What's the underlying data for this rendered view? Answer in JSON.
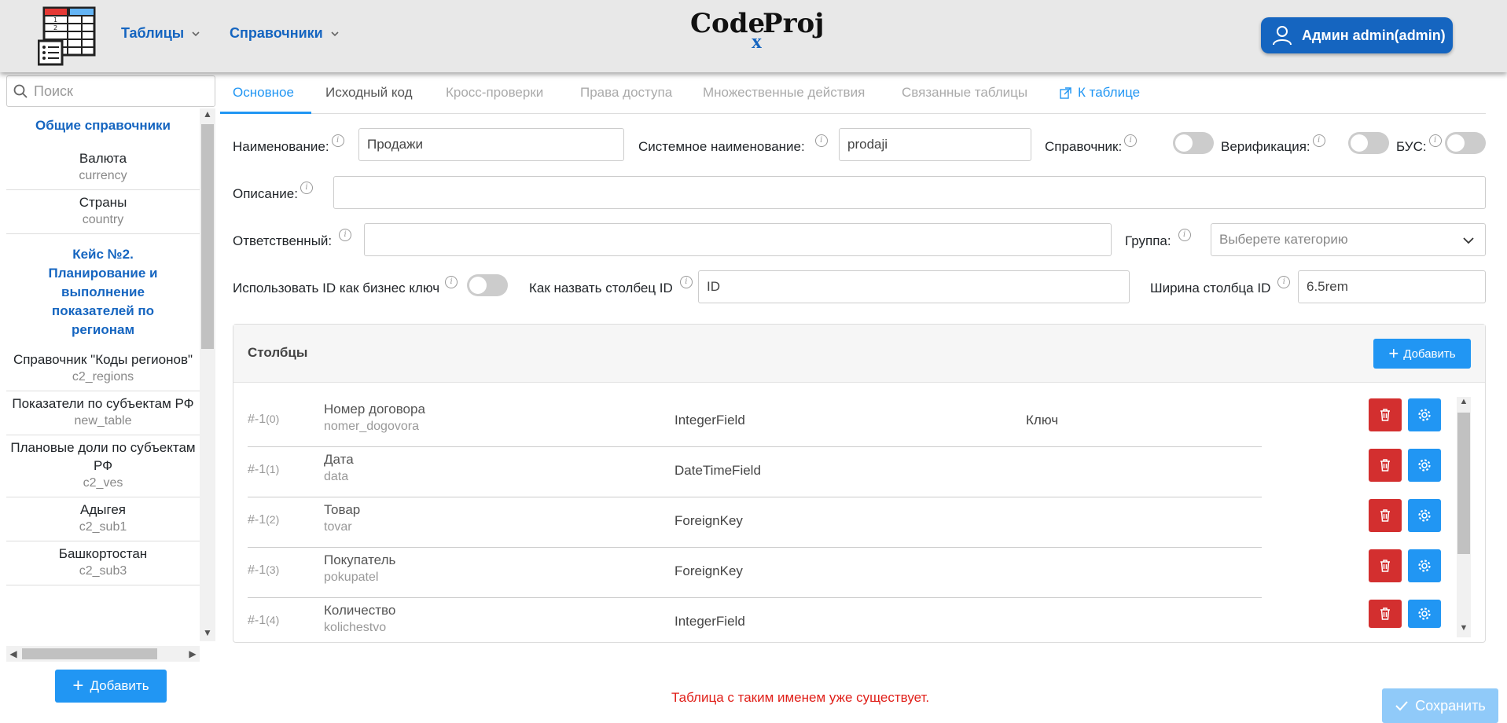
{
  "header": {
    "nav_tables": "Таблицы",
    "nav_directories": "Справочники",
    "brand_code": "Code",
    "brand_x": "x",
    "brand_proj": "Proj",
    "user_label": "Админ admin(admin)"
  },
  "sidebar": {
    "search_placeholder": "Поиск",
    "groups": [
      {
        "label": "Общие справочники"
      },
      {
        "label": "Кейс №2. Планирование и выполнение показателей по регионам"
      }
    ],
    "items": [
      {
        "label": "Валюта",
        "sys": "currency"
      },
      {
        "label": "Страны",
        "sys": "country"
      },
      {
        "label": "Справочник \"Коды регионов\"",
        "sys": "c2_regions"
      },
      {
        "label": "Показатели по субъектам РФ",
        "sys": "new_table"
      },
      {
        "label": "Плановые доли по субъектам РФ",
        "sys": "c2_ves"
      },
      {
        "label": "Адыгея",
        "sys": "c2_sub1"
      },
      {
        "label": "Башкортостан",
        "sys": "c2_sub3"
      }
    ],
    "add_label": "Добавить"
  },
  "tabs": [
    {
      "label": "Основное"
    },
    {
      "label": "Исходный код"
    },
    {
      "label": "Кросс-проверки"
    },
    {
      "label": "Права доступа"
    },
    {
      "label": "Множественные действия"
    },
    {
      "label": "Связанные таблицы"
    },
    {
      "label": "К таблице"
    }
  ],
  "form": {
    "name_label": "Наименование:",
    "name_value": "Продажи",
    "sysname_label": "Системное наименование:",
    "sysname_value": "prodaji",
    "directory_label": "Справочник:",
    "verification_label": "Верификация:",
    "bus_label": "БУС:",
    "description_label": "Описание:",
    "description_value": "",
    "responsible_label": "Ответственный:",
    "responsible_value": "",
    "group_label": "Группа:",
    "group_placeholder": "Выберете категорию",
    "use_id_label": "Использовать ID как бизнес ключ",
    "id_col_name_label": "Как назвать столбец ID",
    "id_col_name_value": "ID",
    "id_col_width_label": "Ширина столбца ID",
    "id_col_width_value": "6.5rem"
  },
  "columns": {
    "title": "Столбцы",
    "add_label": "Добавить",
    "rows": [
      {
        "idx": "#-1",
        "pos": "(0)",
        "name": "Номер договора",
        "sys": "nomer_dogovora",
        "type": "IntegerField",
        "key": "Ключ"
      },
      {
        "idx": "#-1",
        "pos": "(1)",
        "name": "Дата",
        "sys": "data",
        "type": "DateTimeField",
        "key": ""
      },
      {
        "idx": "#-1",
        "pos": "(2)",
        "name": "Товар",
        "sys": "tovar",
        "type": "ForeignKey",
        "key": ""
      },
      {
        "idx": "#-1",
        "pos": "(3)",
        "name": "Покупатель",
        "sys": "pokupatel",
        "type": "ForeignKey",
        "key": ""
      },
      {
        "idx": "#-1",
        "pos": "(4)",
        "name": "Количество",
        "sys": "kolichestvo",
        "type": "IntegerField",
        "key": ""
      }
    ]
  },
  "footer": {
    "error": "Таблица с таким именем уже существует.",
    "save_label": "Сохранить"
  },
  "colors": {
    "accent": "#2196f3",
    "brand_blue": "#1565c0",
    "danger": "#d32f2f",
    "error_text": "#e0201a"
  },
  "icons": {
    "logo": "table-logo-icon",
    "user": "user-icon",
    "search": "search-icon",
    "external": "external-link-icon",
    "delete": "trash-icon",
    "settings": "gear-icon",
    "check": "check-icon"
  }
}
